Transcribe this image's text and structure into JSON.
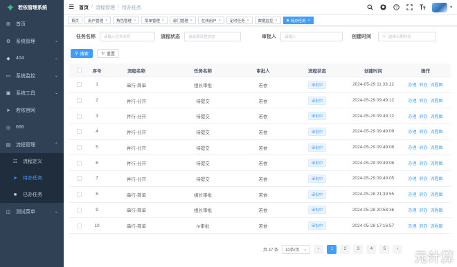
{
  "app": {
    "title": "若依管理系统"
  },
  "sidebar": {
    "items": [
      {
        "label": "首页",
        "icon": "dashboard-icon",
        "glyph": "⊞",
        "arrow": ""
      },
      {
        "label": "系统管理",
        "icon": "gear-icon",
        "glyph": "⚙",
        "arrow": "⌄"
      },
      {
        "label": "404",
        "icon": "bug-icon",
        "glyph": "◆",
        "arrow": "⌄"
      },
      {
        "label": "系统监控",
        "icon": "monitor-icon",
        "glyph": "▭",
        "arrow": "⌄"
      },
      {
        "label": "系统工具",
        "icon": "toolbox-icon",
        "glyph": "▣",
        "arrow": "⌄"
      },
      {
        "label": "若依官网",
        "icon": "send-icon",
        "glyph": "➤",
        "arrow": ""
      },
      {
        "label": "666",
        "icon": "circle-icon",
        "glyph": "◎",
        "arrow": ""
      },
      {
        "label": "流程管理",
        "icon": "flow-icon",
        "glyph": "▤",
        "arrow": "⌃"
      }
    ],
    "sub_items": [
      {
        "label": "流程定义",
        "icon": "flow-def-icon",
        "glyph": "☷"
      },
      {
        "label": "待办任务",
        "icon": "todo-icon",
        "glyph": "➤"
      },
      {
        "label": "已办任务",
        "icon": "done-icon",
        "glyph": "■"
      }
    ],
    "after": [
      {
        "label": "测试菜单",
        "icon": "test-icon",
        "glyph": "◫",
        "arrow": "⌄"
      }
    ]
  },
  "navbar": {
    "breadcrumb": [
      "首页",
      "流程管理",
      "待办任务"
    ],
    "separator": "/"
  },
  "tags": [
    {
      "label": "首页",
      "closable": false,
      "active": false
    },
    {
      "label": "用户管理",
      "closable": true,
      "active": false
    },
    {
      "label": "角色管理",
      "closable": true,
      "active": false
    },
    {
      "label": "菜单管理",
      "closable": true,
      "active": false
    },
    {
      "label": "部门管理",
      "closable": true,
      "active": false
    },
    {
      "label": "在线用户",
      "closable": true,
      "active": false
    },
    {
      "label": "定时任务",
      "closable": true,
      "active": false
    },
    {
      "label": "数据监控",
      "closable": true,
      "active": false
    },
    {
      "label": "待办任务",
      "closable": true,
      "active": true
    }
  ],
  "search": {
    "task_name_label": "任务名称",
    "task_name_placeholder": "请输入任务名称",
    "flow_status_label": "流程状态",
    "flow_status_placeholder": "请选择流程状态",
    "approver_label": "审批人",
    "approver_placeholder": "请输入",
    "created_label": "创建时间",
    "created_placeholder": "选择日期时间",
    "search_btn": "搜索",
    "reset_btn": "重置"
  },
  "table": {
    "headers": [
      "序号",
      "流程名称",
      "任务名称",
      "审批人",
      "流程状态",
      "创建时间",
      "操作"
    ],
    "ops": [
      "办理",
      "转办",
      "流程图"
    ],
    "rows": [
      {
        "idx": "1",
        "flow": "串行-简单",
        "task": "组长审批",
        "approver": "若依",
        "status": "审批中",
        "time": "2024-05-29 11:33:12"
      },
      {
        "idx": "2",
        "flow": "并行-分开",
        "task": "待提交",
        "approver": "若依",
        "status": "审批中",
        "time": "2024-05-29 09:49:12"
      },
      {
        "idx": "3",
        "flow": "并行-分开",
        "task": "待提交",
        "approver": "若依",
        "status": "审批中",
        "time": "2024-05-29 09:49:12"
      },
      {
        "idx": "4",
        "flow": "并行-分开",
        "task": "待提交",
        "approver": "若依",
        "status": "审批中",
        "time": "2024-05-29 09:49:09"
      },
      {
        "idx": "5",
        "flow": "并行-分开",
        "task": "待提交",
        "approver": "若依",
        "status": "审批中",
        "time": "2024-05-29 09:49:08"
      },
      {
        "idx": "6",
        "flow": "并行-分开",
        "task": "待提交",
        "approver": "若依",
        "status": "审批中",
        "time": "2024-05-29 09:49:06"
      },
      {
        "idx": "7",
        "flow": "并行-分开",
        "task": "待提交",
        "approver": "若依",
        "status": "审批中",
        "time": "2024-05-29 09:49:05"
      },
      {
        "idx": "8",
        "flow": "串行-简单",
        "task": "组长审批",
        "approver": "若依",
        "status": "审批中",
        "time": "2024-05-28 21:39:55"
      },
      {
        "idx": "9",
        "flow": "串行-简单",
        "task": "组长审批",
        "approver": "若依",
        "status": "审批中",
        "time": "2024-05-28 20:58:36"
      },
      {
        "idx": "10",
        "flow": "串行-简单",
        "task": "hr审批",
        "approver": "若依",
        "status": "审批中",
        "time": "2024-05-28 17:16:57"
      }
    ]
  },
  "pagination": {
    "total": "共 47 条",
    "size": "10条/页",
    "prev": "‹",
    "pages": [
      "1",
      "2",
      "3",
      "4",
      "5"
    ],
    "current": "1",
    "next": "›"
  },
  "watermark": "元计算",
  "colors": {
    "sidebar": "#304156",
    "primary": "#409eff"
  }
}
